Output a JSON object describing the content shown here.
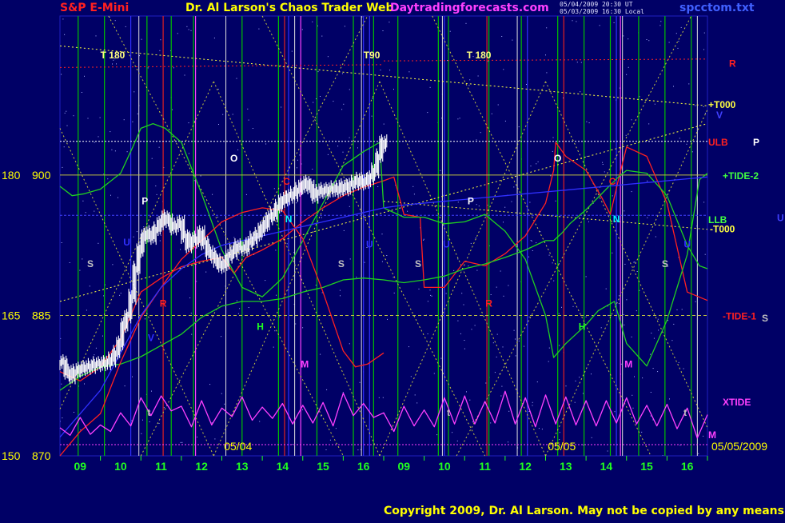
{
  "header": {
    "symbol": "S&P E-Mini",
    "title": "Dr. Al Larson's Chaos Trader Web",
    "site": "Daytradingforecasts.com",
    "stamp_line1": "05/04/2009 20:30 UT",
    "stamp_line2": "05/03/2009 16:30 Local",
    "filename": "spcctom.txt"
  },
  "copyright": "Copyright 2009, Dr. Al Larson. May not be copied by any means.",
  "colors": {
    "background": "#000066",
    "grid_green": "#00cc00",
    "price_bars": "#ffffff",
    "red_line": "#ff2020",
    "green_line": "#20d020",
    "xtide": "#ff40ff",
    "dotted_yellow": "#e0e040",
    "blue_line": "#3030ff"
  },
  "chart_data": {
    "type": "line",
    "y_axis_left_outer": {
      "ticks": [
        {
          "label": "180",
          "value": 900
        },
        {
          "label": "165",
          "value": 885
        },
        {
          "label": "150",
          "value": 870
        }
      ]
    },
    "y_axis_left_inner": {
      "ticks": [
        "900",
        "885",
        "870"
      ]
    },
    "ylim": [
      870,
      917
    ],
    "x_tick_labels": [
      "09",
      "10",
      "11",
      "12",
      "13",
      "14",
      "15",
      "16",
      "09",
      "10",
      "11",
      "12",
      "13",
      "14",
      "15",
      "16"
    ],
    "date_labels": [
      "05/04",
      "05/05",
      "05/05/2009"
    ],
    "right_labels": [
      {
        "text": "R",
        "value": 912,
        "color": "#ff2020"
      },
      {
        "text": "+T000",
        "value": 907.6,
        "color": "#ffff40"
      },
      {
        "text": "V",
        "value": 906.5,
        "color": "#4040ff"
      },
      {
        "text": "ULB",
        "value": 903.6,
        "color": "#ff2020"
      },
      {
        "text": "P",
        "value": 903.6,
        "color": "#ffffff"
      },
      {
        "text": "+TIDE-2",
        "value": 900,
        "color": "#40ff40"
      },
      {
        "text": "U",
        "value": 895.5,
        "color": "#4040ff"
      },
      {
        "text": "LLB",
        "value": 895.3,
        "color": "#40ff40"
      },
      {
        "text": "-T000",
        "value": 894.3,
        "color": "#ffff40"
      },
      {
        "text": "-TIDE-1",
        "value": 885,
        "color": "#ff2020"
      },
      {
        "text": "S",
        "value": 884.8,
        "color": "#c0c0c0"
      },
      {
        "text": "XTIDE",
        "value": 875.8,
        "color": "#ff40ff"
      },
      {
        "text": "M",
        "value": 872.3,
        "color": "#ff40ff"
      }
    ],
    "top_markers": [
      {
        "text": "T 180",
        "slot": 1.0
      },
      {
        "text": "T90",
        "slot": 7.5
      },
      {
        "text": "T 180",
        "slot": 10.05
      }
    ],
    "planet_markers": [
      {
        "text": "O",
        "slot": 4.3,
        "value": 901.8,
        "color": "#ffffff"
      },
      {
        "text": "P",
        "slot": 2.1,
        "value": 897.2,
        "color": "#ffffff"
      },
      {
        "text": "U",
        "slot": 1.65,
        "value": 892.8,
        "color": "#3030ff"
      },
      {
        "text": "S",
        "slot": 0.75,
        "value": 890.5,
        "color": "#c0c0c0"
      },
      {
        "text": "R",
        "slot": 2.55,
        "value": 886.3,
        "color": "#ff2020"
      },
      {
        "text": "V",
        "slot": 2.25,
        "value": 882.6,
        "color": "#3030ff"
      },
      {
        "text": "C",
        "slot": 5.6,
        "value": 899.3,
        "color": "#ff2020"
      },
      {
        "text": "N",
        "slot": 5.65,
        "value": 895.3,
        "color": "#00ffff"
      },
      {
        "text": "H",
        "slot": 4.95,
        "value": 883.8,
        "color": "#20ff20"
      },
      {
        "text": "M",
        "slot": 6.05,
        "value": 879.8,
        "color": "#ff40ff"
      },
      {
        "text": "S",
        "slot": 6.95,
        "value": 890.5,
        "color": "#c0c0c0"
      },
      {
        "text": "U",
        "slot": 7.65,
        "value": 892.6,
        "color": "#3030ff"
      },
      {
        "text": "t",
        "slot": 2.2,
        "value": 874.6,
        "color": "#c0c0c0"
      },
      {
        "text": "S",
        "slot": 8.85,
        "value": 890.5,
        "color": "#c0c0c0"
      },
      {
        "text": "U",
        "slot": 9.55,
        "value": 892.6,
        "color": "#3030ff"
      },
      {
        "text": "P",
        "slot": 10.15,
        "value": 897.2,
        "color": "#ffffff"
      },
      {
        "text": "R",
        "slot": 10.6,
        "value": 886.3,
        "color": "#ff2020"
      },
      {
        "text": "t",
        "slot": 9.6,
        "value": 874.6,
        "color": "#c0c0c0"
      },
      {
        "text": "O",
        "slot": 12.3,
        "value": 901.8,
        "color": "#ffffff"
      },
      {
        "text": "C",
        "slot": 13.65,
        "value": 899.3,
        "color": "#ff2020"
      },
      {
        "text": "N",
        "slot": 13.75,
        "value": 895.3,
        "color": "#00ffff"
      },
      {
        "text": "H",
        "slot": 12.9,
        "value": 883.8,
        "color": "#20ff20"
      },
      {
        "text": "M",
        "slot": 14.05,
        "value": 879.8,
        "color": "#ff40ff"
      },
      {
        "text": "S",
        "slot": 14.95,
        "value": 890.5,
        "color": "#c0c0c0"
      },
      {
        "text": "U",
        "slot": 15.5,
        "value": 892.6,
        "color": "#3030ff"
      },
      {
        "text": "t",
        "slot": 15.45,
        "value": 874.6,
        "color": "#c0c0c0"
      }
    ],
    "series": [
      {
        "kind": "price",
        "x": [
          0,
          0.1,
          0.2,
          0.3,
          0.4,
          0.5,
          0.6,
          0.7,
          0.8,
          0.9,
          1.0,
          1.1,
          1.2,
          1.3,
          1.4,
          1.5,
          1.6,
          1.7,
          1.8,
          1.9,
          2.0,
          2.1,
          2.2,
          2.3,
          2.4,
          2.5,
          2.6,
          2.7,
          2.8,
          2.9,
          3.0,
          3.1,
          3.2,
          3.3,
          3.4,
          3.5,
          3.6,
          3.7,
          3.8,
          3.9,
          4.0,
          4.1,
          4.2,
          4.3,
          4.4,
          4.5,
          4.6,
          4.7,
          4.8,
          4.9,
          5.0,
          5.1,
          5.2,
          5.3,
          5.4,
          5.5,
          5.6,
          5.7,
          5.8,
          5.9,
          6.0,
          6.1,
          6.2,
          6.3,
          6.4,
          6.5,
          6.6,
          6.7,
          6.8,
          6.9,
          7.0,
          7.1,
          7.2,
          7.3,
          7.4,
          7.5,
          7.6,
          7.7,
          7.8,
          7.9,
          8.0
        ],
        "values": [
          880,
          879,
          878.5,
          879,
          879.2,
          879.4,
          879.5,
          879.6,
          879.8,
          879.8,
          879.9,
          880,
          880.3,
          881,
          882,
          884,
          885,
          887,
          890,
          892,
          893.5,
          893.8,
          893.4,
          894.2,
          894.8,
          895.5,
          895.2,
          894.4,
          894.6,
          894.9,
          893.5,
          892.5,
          893.2,
          893,
          893.8,
          892.8,
          891.8,
          891.4,
          890.8,
          890.3,
          890.6,
          891.4,
          891.8,
          892.4,
          892.2,
          892.2,
          892.8,
          893.2,
          893.6,
          894.2,
          894.8,
          895.5,
          895.8,
          896.6,
          897.2,
          897.5,
          897.8,
          898,
          898.4,
          898.8,
          899.2,
          898.8,
          897.8,
          898.2,
          898.4,
          898.3,
          898.5,
          898.6,
          898.4,
          898.8,
          898.6,
          899,
          899.2,
          899.5,
          899.2,
          899.4,
          899.8,
          900.5,
          902,
          903.5,
          903.2
        ]
      },
      {
        "kind": "line",
        "name": "",
        "color": "#ff2020",
        "x": [
          0,
          0.5,
          1.0,
          1.5,
          2.0,
          2.5,
          3.0,
          3.5,
          4.0,
          4.3,
          4.6,
          5.0,
          5.5,
          6.0,
          6.5,
          7.0,
          7.5,
          8.0,
          8.25,
          8.5,
          8.9,
          9.0,
          9.5,
          10.0,
          10.5,
          11.0,
          11.5,
          12.0,
          12.2,
          12.25,
          12.5,
          13.0,
          13.4,
          13.6,
          13.8,
          14.0,
          14.5,
          15.0,
          15.5,
          16.0
        ],
        "values": [
          879,
          878,
          879.5,
          882.5,
          887.5,
          889,
          890.2,
          890.8,
          891.2,
          889.5,
          891.2,
          892,
          893.2,
          895,
          896.5,
          897.8,
          898.7,
          899.4,
          899.8,
          895.8,
          895.5,
          888,
          888,
          890.8,
          890.3,
          891.6,
          893.5,
          897,
          900.5,
          903.5,
          902,
          900.5,
          897.5,
          895.8,
          899.5,
          903,
          902,
          897,
          887.5,
          886.6
        ]
      },
      {
        "kind": "line",
        "name": "",
        "color": "#20d020",
        "x": [
          0,
          0.3,
          0.6,
          1.0,
          1.5,
          1.8,
          2.0,
          2.3,
          2.6,
          3.0,
          3.5,
          4.0,
          4.5,
          5.0,
          5.5,
          6.0,
          6.5,
          7.0,
          7.5,
          7.9,
          8.0,
          8.5,
          9.0,
          9.5,
          10.0,
          10.5,
          11.0,
          11.5,
          12.0,
          12.2,
          12.5,
          13.0,
          13.3,
          13.7,
          14.0,
          14.5,
          15.0,
          15.5,
          15.8,
          16.0
        ],
        "values": [
          898.8,
          897.8,
          898,
          898.5,
          900.2,
          903,
          905,
          905.5,
          905,
          903.5,
          898,
          892,
          888,
          887,
          889,
          893,
          897,
          901,
          902.5,
          903.5,
          896.5,
          895.5,
          895.5,
          894.8,
          895,
          895.8,
          894,
          891,
          885,
          880.5,
          882,
          884,
          885.5,
          886.5,
          882,
          879.6,
          884.5,
          891.5,
          899.5,
          900.2
        ]
      },
      {
        "kind": "line",
        "name": "",
        "color": "#20d020",
        "x": [
          0,
          0.5,
          1.0,
          1.5,
          2.0,
          2.5,
          3.0,
          3.5,
          4.0,
          4.5,
          5.0,
          5.5,
          6.0,
          6.5,
          7.0,
          7.5,
          8.0,
          8.5,
          9.0,
          9.5,
          10.0,
          10.5,
          11.0,
          11.5,
          12.0,
          12.2,
          12.4,
          12.6,
          13.0,
          13.5,
          13.8,
          14.0,
          14.5,
          15.0,
          15.5,
          15.8,
          16.0
        ],
        "values": [
          877,
          878.5,
          879.5,
          879.8,
          880.6,
          881.8,
          883,
          884.8,
          886,
          886.5,
          886.5,
          886.8,
          887.5,
          888,
          888.8,
          889,
          888.8,
          888.5,
          888.8,
          889.2,
          890,
          890.5,
          891.2,
          892,
          893,
          893,
          893.8,
          894.8,
          896.3,
          898.5,
          899.8,
          900.5,
          900.2,
          897.8,
          892.5,
          890.3,
          890
        ]
      },
      {
        "kind": "line",
        "name": "",
        "color": "#ff2020",
        "x": [
          0,
          0.5,
          1.0,
          1.5,
          2.0,
          2.5,
          3.0,
          3.5,
          4.0,
          4.5,
          5.0,
          5.5,
          6.0,
          6.5,
          7.0,
          7.3,
          7.6,
          8.0
        ],
        "values": [
          870,
          872.6,
          874.5,
          880,
          884.8,
          888,
          891,
          893,
          895,
          896,
          896.5,
          896.2,
          893.2,
          887.5,
          881.2,
          879.5,
          879.8,
          881
        ]
      },
      {
        "kind": "line",
        "name": "",
        "color": "#3030ff",
        "x": [
          0,
          0.5,
          1.0,
          1.5,
          2.0,
          2.5,
          3.0,
          3.5,
          4.0,
          4.5,
          5.0,
          5.5,
          6.0,
          6.5,
          7.0,
          7.5,
          8.0,
          8.5,
          9.0,
          9.5,
          10.0,
          10.5,
          11.0,
          11.5,
          12.0,
          12.5,
          13.0,
          13.5,
          14.0,
          14.5,
          15.0,
          15.5,
          16.0
        ],
        "values": [
          872,
          874.5,
          877,
          881,
          885,
          888,
          890,
          891.5,
          892.5,
          893,
          893.5,
          894,
          894.5,
          895,
          895.5,
          896,
          896.5,
          896.8,
          897,
          897.2,
          897.4,
          897.6,
          897.8,
          898,
          898.2,
          898.4,
          898.6,
          898.8,
          899,
          899.2,
          899.4,
          899.6,
          899.8
        ]
      },
      {
        "kind": "xtide",
        "name": "XTIDE",
        "color": "#ff40ff",
        "x": [
          0,
          0.25,
          0.5,
          0.75,
          1.0,
          1.25,
          1.5,
          1.75,
          2.0,
          2.25,
          2.5,
          2.75,
          3.0,
          3.25,
          3.5,
          3.75,
          4.0,
          4.25,
          4.5,
          4.75,
          5.0,
          5.25,
          5.5,
          5.75,
          6.0,
          6.25,
          6.5,
          6.75,
          7.0,
          7.25,
          7.5,
          7.75,
          8.0,
          8.25,
          8.5,
          8.75,
          9.0,
          9.25,
          9.5,
          9.75,
          10.0,
          10.25,
          10.5,
          10.75,
          11.0,
          11.25,
          11.5,
          11.75,
          12.0,
          12.25,
          12.5,
          12.75,
          13.0,
          13.25,
          13.5,
          13.75,
          14.0,
          14.25,
          14.5,
          14.75,
          15.0,
          15.25,
          15.5,
          15.75,
          16.0
        ],
        "values": [
          873,
          872.2,
          874.1,
          872.3,
          873.3,
          872.6,
          874.6,
          873.2,
          876.2,
          874.3,
          876.4,
          874.8,
          875.3,
          873.1,
          875.9,
          873.3,
          875.1,
          874.2,
          876.3,
          873.8,
          875.2,
          874,
          875.6,
          873.4,
          875.4,
          873.5,
          875.7,
          873.2,
          876.7,
          874.3,
          875.6,
          874.1,
          874.6,
          872.6,
          875.3,
          873.2,
          874.9,
          873.1,
          876.2,
          873.4,
          876.4,
          873.4,
          875.8,
          873.5,
          876.9,
          873.4,
          876.2,
          873.1,
          876.5,
          873.4,
          876.3,
          873.3,
          875.9,
          873.2,
          875.9,
          873.5,
          876.2,
          873.4,
          875.4,
          873.2,
          875.5,
          872.9,
          875.1,
          871.9,
          874.4
        ]
      }
    ],
    "vertical_lines_green": [
      0.45,
      1.1,
      2.15,
      2.75,
      3.3,
      4.5,
      5.4,
      6.35,
      7.25,
      7.75,
      8.35,
      9.35,
      9.6,
      10.6,
      11.4,
      12.3,
      12.95,
      13.6,
      14.3,
      14.95,
      15.6
    ],
    "vertical_lines_white": [
      1.95,
      4.1,
      5.8,
      7.45,
      9.45,
      11.3,
      13.9,
      15.75
    ],
    "vertical_lines_blue": [
      1.75,
      5.65,
      7.5,
      7.65,
      9.5,
      11.55,
      13.75
    ],
    "vertical_lines_red": [
      2.55,
      5.55,
      10.55,
      12.45
    ],
    "vertical_lines_magenta": [
      3.35,
      5.95,
      13.85
    ],
    "horizontal_lines": [
      {
        "value": 900,
        "color": "#c0c040",
        "dash": "none"
      },
      {
        "value": 885,
        "color": "#c0c040",
        "dash": "4,3"
      },
      {
        "value": 903.6,
        "color": "#ffffff",
        "dash": "2,2"
      },
      {
        "value": 895.7,
        "color": "#4040ff",
        "dash": "3,2"
      },
      {
        "value": 871.2,
        "color": "#ff40ff",
        "dash": "2,2"
      }
    ],
    "dotted_trend_lines": [
      {
        "x1": 0,
        "y1": 913.8,
        "x2": 16,
        "y2": 907.4,
        "color": "#ffff40"
      },
      {
        "x1": 0,
        "y1": 886.5,
        "x2": 16,
        "y2": 905.5,
        "color": "#ffff40"
      },
      {
        "x1": 8,
        "y1": 897.2,
        "x2": 16,
        "y2": 894.2,
        "color": "#ffff40"
      },
      {
        "x1": 0,
        "y1": 911.5,
        "x2": 8,
        "y2": 911.8,
        "color": "#ff2020"
      },
      {
        "x1": 8,
        "y1": 912.2,
        "x2": 16,
        "y2": 912.4,
        "color": "#ff2020"
      }
    ],
    "diamond_lines": [
      {
        "x1": 0,
        "y1": 905,
        "x2": 3.8,
        "y2": 870
      },
      {
        "x1": 0,
        "y1": 875,
        "x2": 3.8,
        "y2": 910
      },
      {
        "x1": 3.8,
        "y1": 870,
        "x2": 7.9,
        "y2": 910
      },
      {
        "x1": 3.8,
        "y1": 910,
        "x2": 7.9,
        "y2": 870
      },
      {
        "x1": 7.9,
        "y1": 910,
        "x2": 12.0,
        "y2": 870
      },
      {
        "x1": 7.9,
        "y1": 870,
        "x2": 12.0,
        "y2": 910
      },
      {
        "x1": 12.0,
        "y1": 870,
        "x2": 16,
        "y2": 907
      },
      {
        "x1": 12.0,
        "y1": 910,
        "x2": 16,
        "y2": 873
      },
      {
        "x1": 1.2,
        "y1": 917,
        "x2": 7.0,
        "y2": 870
      },
      {
        "x1": 5.0,
        "y1": 917,
        "x2": 10.5,
        "y2": 870
      },
      {
        "x1": 9.2,
        "y1": 917,
        "x2": 14.6,
        "y2": 870
      },
      {
        "x1": 2.0,
        "y1": 870,
        "x2": 7.6,
        "y2": 917
      },
      {
        "x1": 9.8,
        "y1": 870,
        "x2": 15.6,
        "y2": 917
      }
    ]
  }
}
